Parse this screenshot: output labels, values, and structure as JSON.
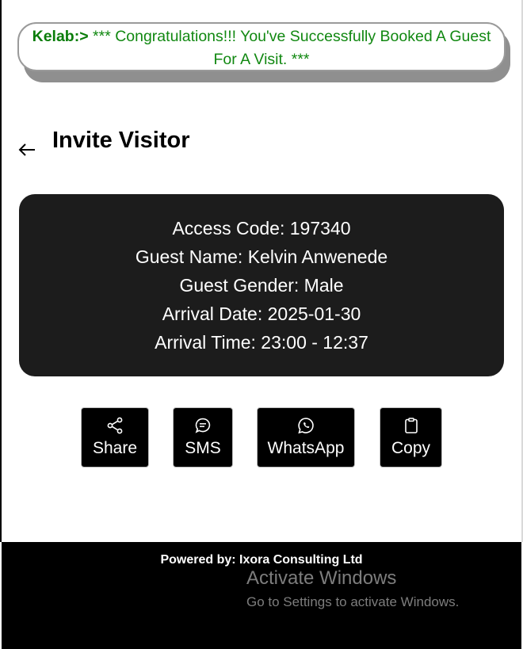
{
  "banner": {
    "tag": "Kelab:>",
    "message": " *** Congratulations!!! You've Successfully Booked A Guest For A Visit. ***",
    "color": "#118811"
  },
  "header": {
    "back_icon": "arrow-left-icon",
    "title": "Invite Visitor"
  },
  "details": {
    "access_code": "Access Code: 197340",
    "guest_name": "Guest Name: Kelvin Anwenede",
    "guest_gender": "Guest Gender: Male",
    "arrival_date": "Arrival Date: 2025-01-30",
    "arrival_time": "Arrival Time: 23:00 - 12:37"
  },
  "actions": [
    {
      "label": "Share",
      "icon": "share-icon"
    },
    {
      "label": "SMS",
      "icon": "chat-icon"
    },
    {
      "label": "WhatsApp",
      "icon": "whatsapp-icon"
    },
    {
      "label": "Copy",
      "icon": "clipboard-icon"
    }
  ],
  "footer": {
    "powered_by": "Powered by: Ixora Consulting Ltd"
  },
  "watermark": {
    "title": "Activate Windows",
    "subtitle": "Go to Settings to activate Windows."
  }
}
